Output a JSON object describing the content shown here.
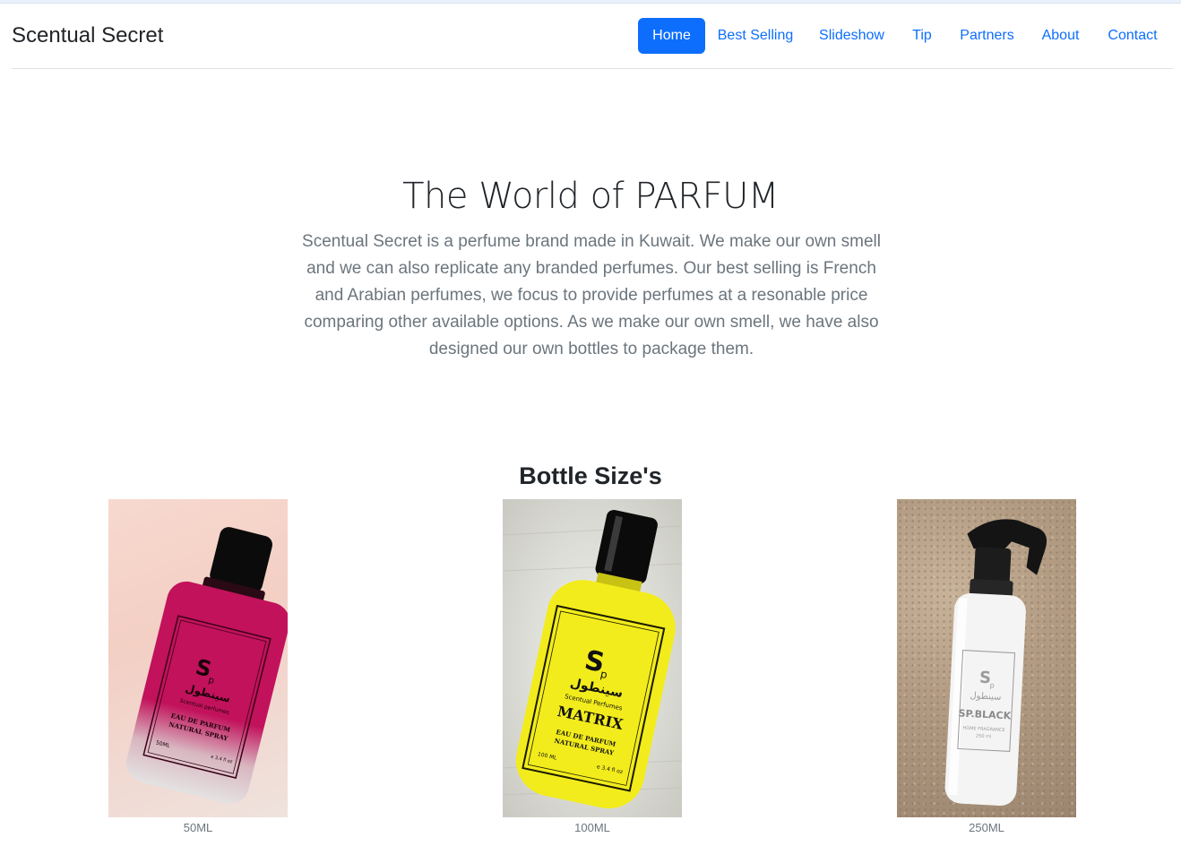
{
  "brand": "Scentual Secret",
  "nav": {
    "items": [
      {
        "label": "Home",
        "active": true
      },
      {
        "label": "Best Selling",
        "active": false
      },
      {
        "label": "Slideshow",
        "active": false
      },
      {
        "label": "Tip",
        "active": false
      },
      {
        "label": "Partners",
        "active": false
      },
      {
        "label": "About",
        "active": false
      },
      {
        "label": "Contact",
        "active": false
      }
    ]
  },
  "hero": {
    "title": "The World of PARFUM",
    "text": "Scentual Secret is a perfume brand made in Kuwait. We make our own smell and we can also replicate any branded perfumes. Our best selling is French and Arabian perfumes, we focus to provide perfumes at a resonable price comparing other available options. As we make our own smell, we have also designed our own bottles to package them."
  },
  "bottles": {
    "title": "Bottle Size's",
    "items": [
      {
        "caption": "50ML",
        "bottle_color": "#c2125c",
        "label_name": "Scentual perfumes",
        "label_lines": [
          "EAU DE PARFUM",
          "NATURAL SPRAY"
        ],
        "size_text": "50ML",
        "oz_text": "e 3.4 fl oz"
      },
      {
        "caption": "100ML",
        "bottle_color": "#f2ec1c",
        "label_name": "Scentual Perfumes",
        "product_name": "MATRIX",
        "label_lines": [
          "EAU DE PARFUM",
          "NATURAL SPRAY"
        ],
        "size_text": "100 ML",
        "oz_text": "e 3.4 fl oz"
      },
      {
        "caption": "250ML",
        "bottle_color": "#f4f4f4",
        "product_name": "SP.BLACK",
        "label_lines": [
          "HOME FRAGRANCE",
          "250 ml"
        ]
      }
    ]
  },
  "colors": {
    "primary": "#0d6efd",
    "muted": "#6c757d"
  }
}
